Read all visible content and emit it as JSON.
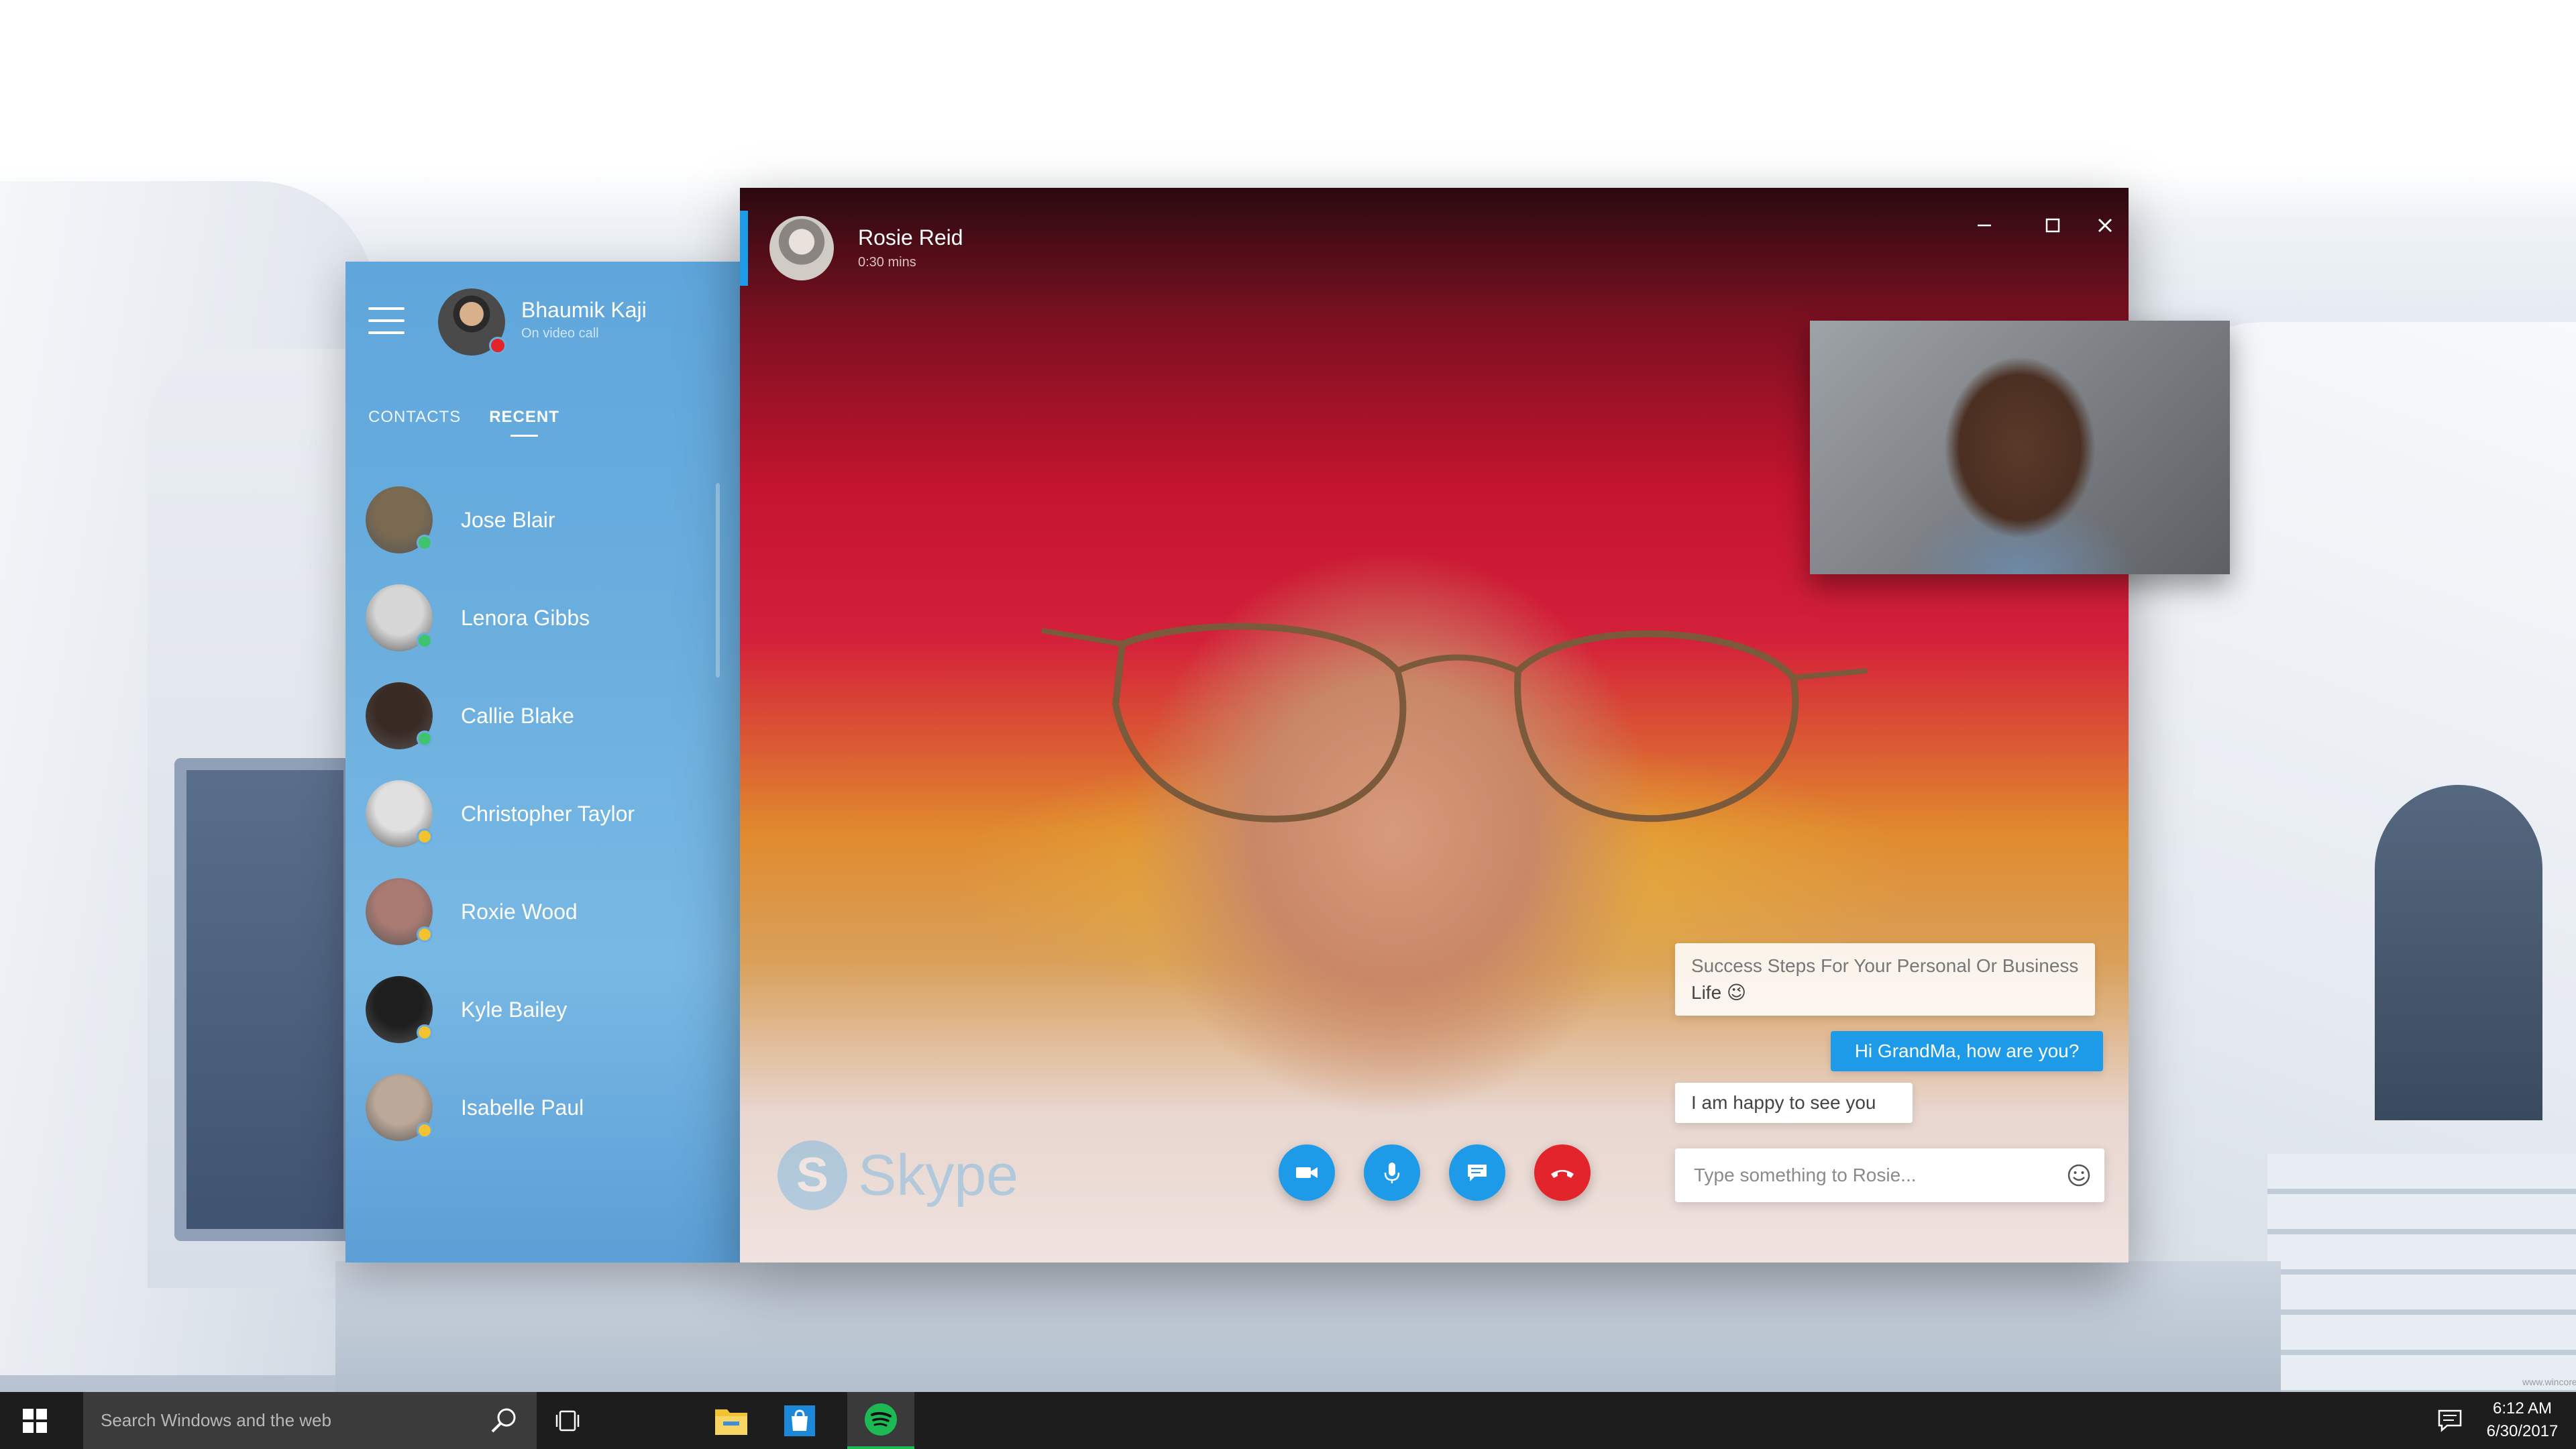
{
  "profile": {
    "name": "Bhaumik Kaji",
    "status": "On video call",
    "status_color": "#e3242b"
  },
  "tabs": [
    {
      "label": "CONTACTS",
      "active": false
    },
    {
      "label": "RECENT",
      "active": true
    }
  ],
  "contacts": [
    {
      "name": "Jose Blair",
      "presence": "online",
      "presence_color": "#3ec46d",
      "avatar_color": "#7a6a52"
    },
    {
      "name": "Lenora Gibbs",
      "presence": "online",
      "presence_color": "#3ec46d",
      "avatar_color": "#d6d6d6"
    },
    {
      "name": "Callie Blake",
      "presence": "online",
      "presence_color": "#3ec46d",
      "avatar_color": "#3a2a24"
    },
    {
      "name": "Christopher Taylor",
      "presence": "away",
      "presence_color": "#f2c230",
      "avatar_color": "#e0e0e0"
    },
    {
      "name": "Roxie Wood",
      "presence": "away",
      "presence_color": "#f2c230",
      "avatar_color": "#a87a72"
    },
    {
      "name": "Kyle Bailey",
      "presence": "away",
      "presence_color": "#f2c230",
      "avatar_color": "#1e1e1e"
    },
    {
      "name": "Isabelle Paul",
      "presence": "away",
      "presence_color": "#f2c230",
      "avatar_color": "#bca898"
    }
  ],
  "call": {
    "caller_name": "Rosie Reid",
    "duration": "0:30 mins",
    "accent_color": "#1e9be8",
    "end_call_color": "#e3242b"
  },
  "chat": {
    "messages": [
      {
        "from": "them",
        "line1": "Success Steps For Your Personal Or Business",
        "line2": "Life 😉"
      },
      {
        "from": "me",
        "text": "Hi GrandMa, how are you?"
      },
      {
        "from": "them",
        "text": "I am happy to see you"
      }
    ],
    "input_placeholder": "Type something to Rosie..."
  },
  "watermark": {
    "letter": "S",
    "text": "Skype"
  },
  "taskbar": {
    "search_placeholder": "Search Windows and the web",
    "pinned": [
      "file-explorer-icon",
      "store-icon",
      "spotify-icon"
    ],
    "active_app": "spotify-icon",
    "time": "6:12 AM",
    "date": "6/30/2017"
  },
  "corner_text": "www.wincore.ru"
}
